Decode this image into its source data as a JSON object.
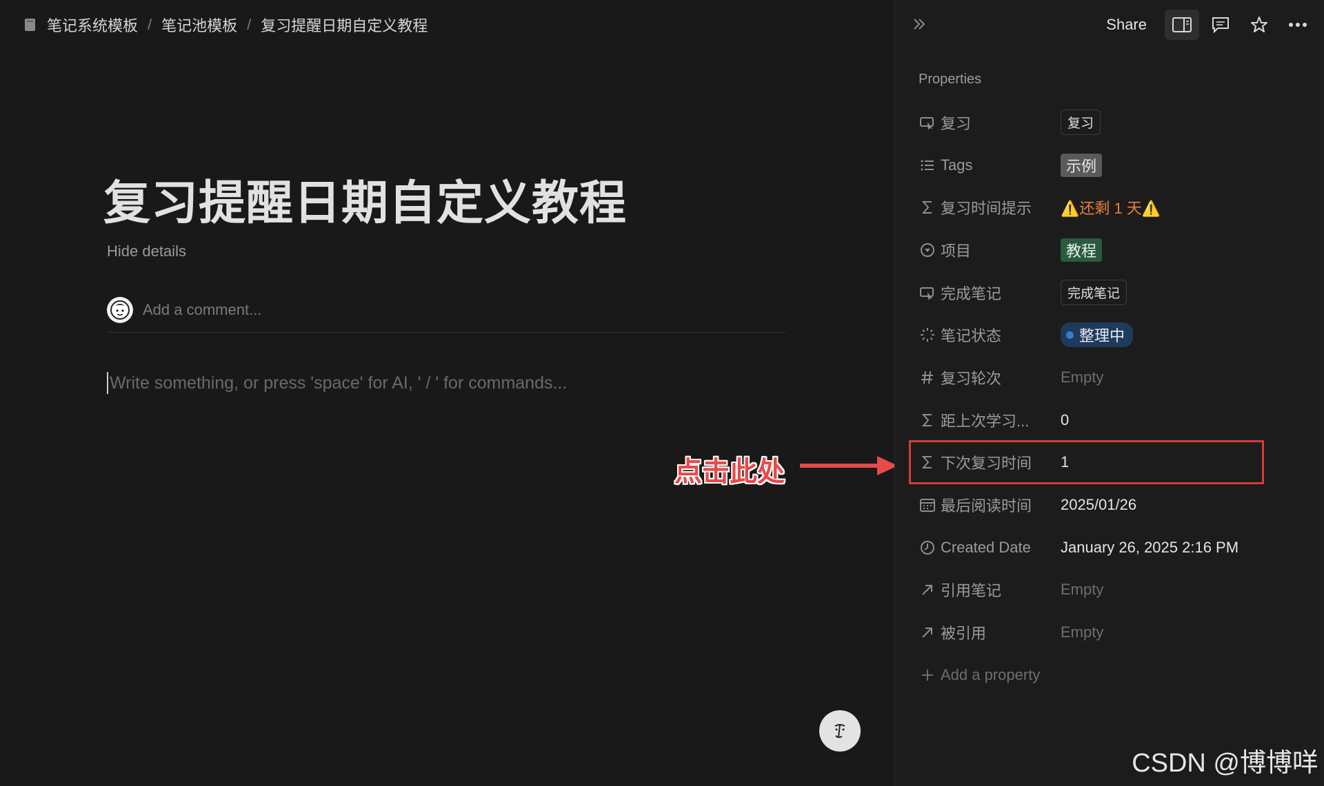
{
  "breadcrumb": {
    "items": [
      "笔记系统模板",
      "笔记池模板",
      "复习提醒日期自定义教程"
    ],
    "separator": "/"
  },
  "page": {
    "title": "复习提醒日期自定义教程",
    "hide_details": "Hide details",
    "comment_placeholder": "Add a comment...",
    "editor_placeholder": "Write something, or press 'space' for AI, ' / ' for commands..."
  },
  "annotation": {
    "text": "点击此处",
    "color": "#e84a4a"
  },
  "toolbar": {
    "share": "Share"
  },
  "properties": {
    "heading": "Properties",
    "rows": [
      {
        "icon": "button-icon",
        "name": "复习",
        "value": "复习",
        "style": "button"
      },
      {
        "icon": "list-icon",
        "name": "Tags",
        "value": "示例",
        "style": "tag-gray"
      },
      {
        "icon": "formula-icon",
        "name": "复习时间提示",
        "value": "⚠️还剩 1 天⚠️",
        "style": "warning"
      },
      {
        "icon": "relation-select-icon",
        "name": "项目",
        "value": "教程",
        "style": "tag-green"
      },
      {
        "icon": "button-icon",
        "name": "完成笔记",
        "value": "完成笔记",
        "style": "button"
      },
      {
        "icon": "status-icon",
        "name": "笔记状态",
        "value": "整理中",
        "style": "status"
      },
      {
        "icon": "number-icon",
        "name": "复习轮次",
        "value": "Empty",
        "style": "empty"
      },
      {
        "icon": "formula-icon",
        "name": "距上次学习...",
        "value": "0",
        "style": "text"
      },
      {
        "icon": "formula-icon",
        "name": "下次复习时间",
        "value": "1",
        "style": "text",
        "highlighted": true
      },
      {
        "icon": "calendar-icon",
        "name": "最后阅读时间",
        "value": "2025/01/26",
        "style": "text"
      },
      {
        "icon": "clock-icon",
        "name": "Created Date",
        "value": "January 26, 2025 2:16 PM",
        "style": "text"
      },
      {
        "icon": "relation-arrow-icon",
        "name": "引用笔记",
        "value": "Empty",
        "style": "empty"
      },
      {
        "icon": "relation-arrow-icon",
        "name": "被引用",
        "value": "Empty",
        "style": "empty"
      }
    ],
    "add_label": "Add a property"
  },
  "watermark": "CSDN @博博咩",
  "colors": {
    "background": "#191919",
    "highlight_border": "#d93a3a",
    "status_dot": "#2f7fd6"
  }
}
